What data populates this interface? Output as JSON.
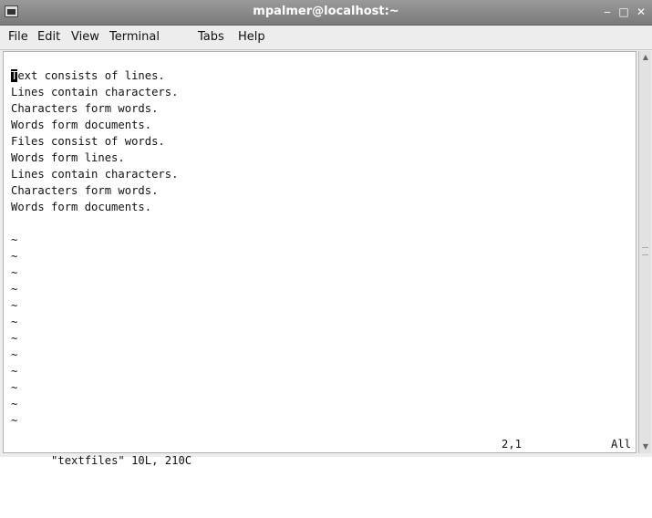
{
  "window": {
    "title": "mpalmer@localhost:~",
    "controls": {
      "minimize": "‒",
      "maximize": "□",
      "close": "✕"
    }
  },
  "menu": {
    "items": [
      {
        "label": "File"
      },
      {
        "label": "Edit"
      },
      {
        "label": "View"
      },
      {
        "label": "Terminal"
      },
      {
        "label": "Tabs"
      },
      {
        "label": "Help"
      }
    ]
  },
  "editor": {
    "lines": [
      "Text consists of lines.",
      "Lines contain characters.",
      "Characters form words.",
      "Words form documents.",
      "Files consist of words.",
      "Words form lines.",
      "Lines contain characters.",
      "Characters form words.",
      "Words form documents.",
      "",
      "~",
      "~",
      "~",
      "~",
      "~",
      "~",
      "~",
      "~",
      "~",
      "~",
      "~",
      "~"
    ],
    "cursor_char": "T",
    "first_line_rest": "ext consists of lines.",
    "status": {
      "file_info": "\"textfiles\" 10L, 210C",
      "position": "2,1",
      "scroll": "All"
    }
  }
}
